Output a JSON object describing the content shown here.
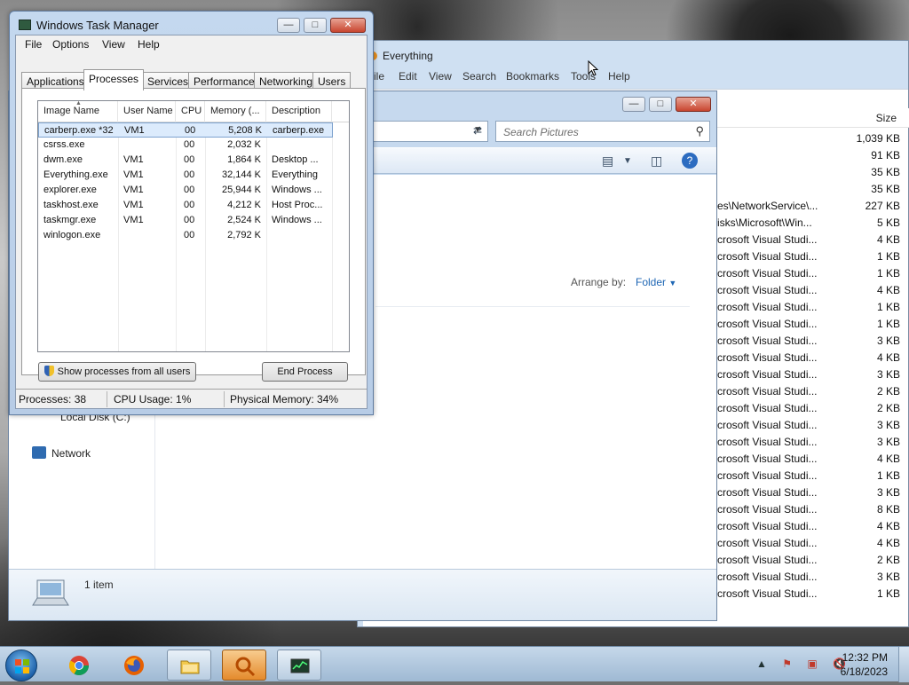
{
  "everything_window": {
    "title": "Everything",
    "menu": [
      "ile",
      "Edit",
      "View",
      "Search",
      "Bookmarks",
      "Tools",
      "Help"
    ],
    "size_header": "Size",
    "rows": [
      {
        "path": "",
        "size": "1,039 KB"
      },
      {
        "path": "",
        "size": "91 KB"
      },
      {
        "path": "",
        "size": "35 KB"
      },
      {
        "path": "",
        "size": "35 KB"
      },
      {
        "path": "es\\NetworkService\\...",
        "size": "227 KB"
      },
      {
        "path": "isks\\Microsoft\\Win...",
        "size": "5 KB"
      },
      {
        "path": "crosoft Visual Studi...",
        "size": "4 KB"
      },
      {
        "path": "crosoft Visual Studi...",
        "size": "1 KB"
      },
      {
        "path": "crosoft Visual Studi...",
        "size": "1 KB"
      },
      {
        "path": "crosoft Visual Studi...",
        "size": "4 KB"
      },
      {
        "path": "crosoft Visual Studi...",
        "size": "1 KB"
      },
      {
        "path": "crosoft Visual Studi...",
        "size": "1 KB"
      },
      {
        "path": "crosoft Visual Studi...",
        "size": "3 KB"
      },
      {
        "path": "crosoft Visual Studi...",
        "size": "4 KB"
      },
      {
        "path": "crosoft Visual Studi...",
        "size": "3 KB"
      },
      {
        "path": "crosoft Visual Studi...",
        "size": "2 KB"
      },
      {
        "path": "crosoft Visual Studi...",
        "size": "2 KB"
      },
      {
        "path": "crosoft Visual Studi...",
        "size": "3 KB"
      },
      {
        "path": "crosoft Visual Studi...",
        "size": "3 KB"
      },
      {
        "path": "crosoft Visual Studi...",
        "size": "4 KB"
      },
      {
        "path": "crosoft Visual Studi...",
        "size": "1 KB"
      },
      {
        "path": "crosoft Visual Studi...",
        "size": "3 KB"
      },
      {
        "path": "crosoft Visual Studi...",
        "size": "8 KB"
      },
      {
        "path": "crosoft Visual Studi...",
        "size": "4 KB"
      },
      {
        "path": "crosoft Visual Studi...",
        "size": "4 KB"
      },
      {
        "path": "crosoft Visual Studi...",
        "size": "2 KB"
      },
      {
        "path": "crosoft Visual Studi...",
        "size": "3 KB"
      },
      {
        "path": "crosoft Visual Studi...",
        "size": "1 KB"
      }
    ]
  },
  "explorer_window": {
    "search_placeholder": "Search Pictures",
    "arrange_by_label": "Arrange by:",
    "arrange_by_value": "Folder",
    "nav_local_disk": "Local Disk (C:)",
    "nav_network": "Network",
    "item_count": "1 item"
  },
  "task_manager": {
    "title": "Windows Task Manager",
    "menu": [
      "File",
      "Options",
      "View",
      "Help"
    ],
    "tabs": [
      "Applications",
      "Processes",
      "Services",
      "Performance",
      "Networking",
      "Users"
    ],
    "active_tab": "Processes",
    "columns": [
      "Image Name",
      "User Name",
      "CPU",
      "Memory (...",
      "Description"
    ],
    "processes": [
      {
        "image": "carberp.exe *32",
        "user": "VM1",
        "cpu": "00",
        "memory": "5,208 K",
        "description": "carberp.exe",
        "selected": true
      },
      {
        "image": "csrss.exe",
        "user": "",
        "cpu": "00",
        "memory": "2,032 K",
        "description": ""
      },
      {
        "image": "dwm.exe",
        "user": "VM1",
        "cpu": "00",
        "memory": "1,864 K",
        "description": "Desktop ..."
      },
      {
        "image": "Everything.exe",
        "user": "VM1",
        "cpu": "00",
        "memory": "32,144 K",
        "description": "Everything"
      },
      {
        "image": "explorer.exe",
        "user": "VM1",
        "cpu": "00",
        "memory": "25,944 K",
        "description": "Windows ..."
      },
      {
        "image": "taskhost.exe",
        "user": "VM1",
        "cpu": "00",
        "memory": "4,212 K",
        "description": "Host Proc..."
      },
      {
        "image": "taskmgr.exe",
        "user": "VM1",
        "cpu": "00",
        "memory": "2,524 K",
        "description": "Windows ..."
      },
      {
        "image": "winlogon.exe",
        "user": "",
        "cpu": "00",
        "memory": "2,792 K",
        "description": ""
      }
    ],
    "show_all_button": "Show processes from all users",
    "end_process_button": "End Process",
    "status": {
      "processes": "Processes: 38",
      "cpu": "CPU Usage: 1%",
      "memory": "Physical Memory: 34%"
    }
  },
  "taskbar": {
    "time": "12:32 PM",
    "date": "6/18/2023",
    "tray_expand": "▲",
    "pinned": [
      "start-orb",
      "chrome",
      "firefox",
      "windows-explorer",
      "everything-search",
      "task-manager"
    ]
  }
}
